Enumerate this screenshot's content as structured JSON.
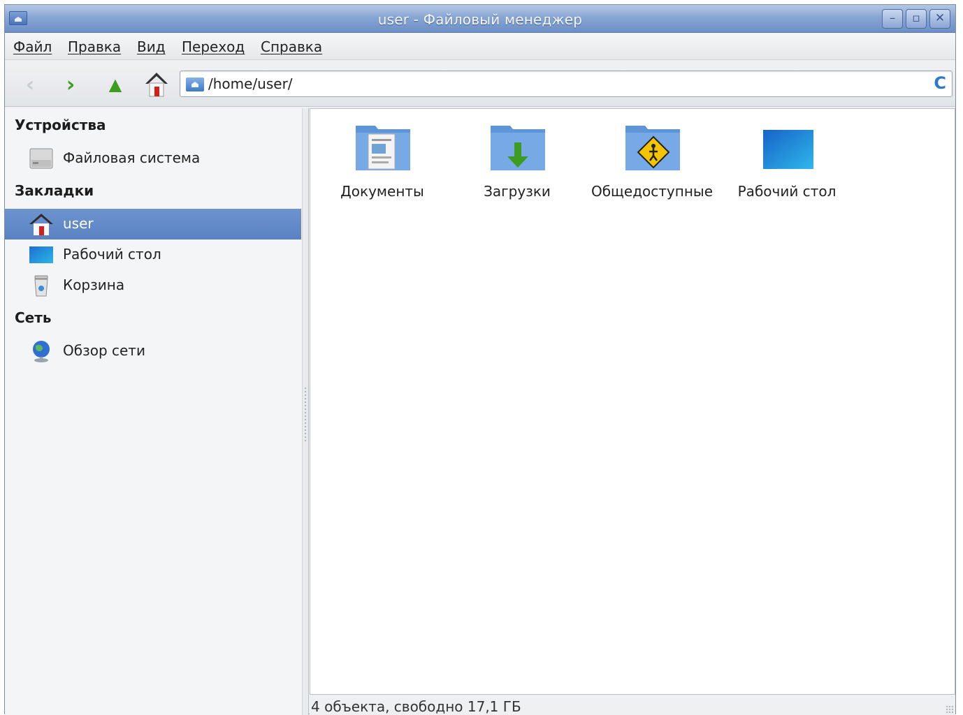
{
  "window": {
    "title": "user - Файловый менеджер",
    "controls": [
      "minimize-icon",
      "maximize-icon",
      "close-icon"
    ]
  },
  "menubar": {
    "items": [
      {
        "label": "Файл"
      },
      {
        "label": "Правка"
      },
      {
        "label": "Вид"
      },
      {
        "label": "Переход"
      },
      {
        "label": "Справка"
      }
    ]
  },
  "toolbar": {
    "back_glyph": "‹",
    "forward_glyph": "›",
    "up_glyph": "▲",
    "address": "/home/user/",
    "reload_glyph": "C"
  },
  "sidepane": {
    "devices_heading": "Устройства",
    "devices": [
      {
        "label": "Файловая система",
        "icon": "harddisk-icon"
      }
    ],
    "bookmarks_heading": "Закладки",
    "bookmarks": [
      {
        "label": "user",
        "icon": "home-icon",
        "selected": true
      },
      {
        "label": "Рабочий стол",
        "icon": "desktop-icon"
      },
      {
        "label": "Корзина",
        "icon": "trash-icon"
      }
    ],
    "network_heading": "Сеть",
    "network": [
      {
        "label": "Обзор сети",
        "icon": "network-globe-icon"
      }
    ]
  },
  "files": [
    {
      "name": "Документы",
      "icon": "documents-folder-icon"
    },
    {
      "name": "Загрузки",
      "icon": "downloads-folder-icon"
    },
    {
      "name": "Общедоступные",
      "icon": "public-folder-icon"
    },
    {
      "name": "Рабочий стол",
      "icon": "desktop-folder-icon"
    }
  ],
  "status": {
    "text": "4 объекта, свободно 17,1 ГБ"
  },
  "colors": {
    "titlebar": "#88a6d4",
    "selection": "#5f88c6",
    "folder_blue": "#3d79c9",
    "nav_green": "#3e9c1e"
  }
}
